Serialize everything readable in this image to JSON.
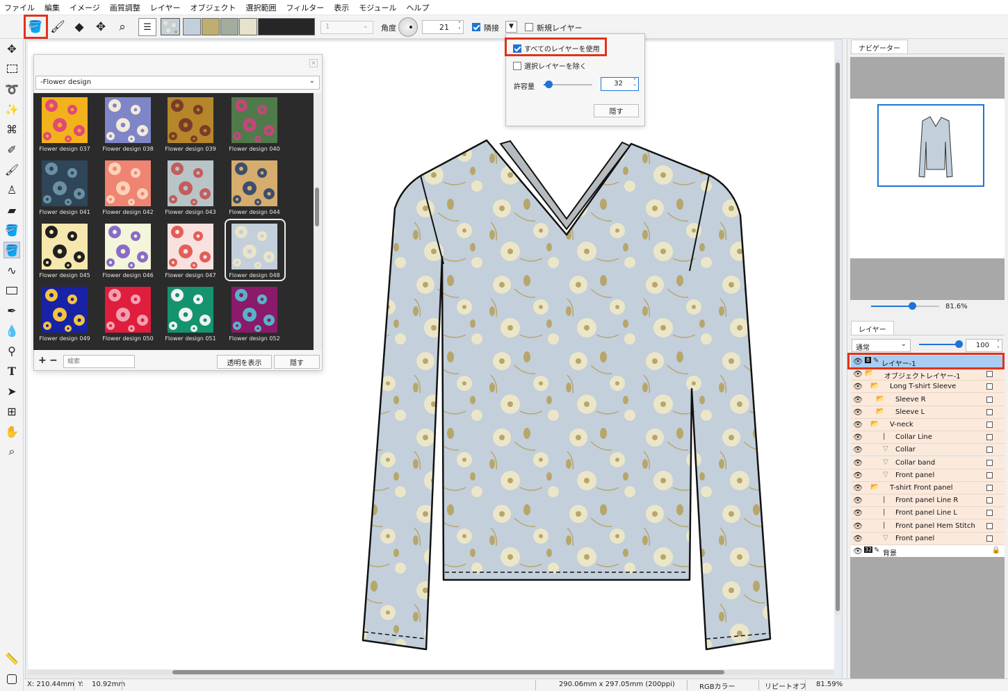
{
  "menu": [
    "ファイル",
    "編集",
    "イメージ",
    "画質調整",
    "レイヤー",
    "オブジェクト",
    "選択範囲",
    "フィルター",
    "表示",
    "モジュール",
    "ヘルプ"
  ],
  "toolbar": {
    "brush_size": "1",
    "angle_label": "角度",
    "angle_value": "21",
    "adjacent_label": "隣接",
    "new_layer_label": "新規レイヤー",
    "swatch_colors": [
      "#c3cfdb",
      "#bfae72",
      "#a3ad9d",
      "#e6e3cc",
      "#262626"
    ]
  },
  "popup": {
    "use_all_layers_label": "すべてのレイヤーを使用",
    "exclude_selected_label": "選択レイヤーを除く",
    "tolerance_label": "許容量",
    "tolerance_value": "32",
    "hide_label": "隠す"
  },
  "palette": {
    "category": "-Flower design",
    "search_placeholder": "検索",
    "show_transparent_label": "透明を表示",
    "hide_label": "隠す",
    "add_symbol": "+",
    "remove_symbol": "−",
    "patterns": [
      {
        "name": "Flower design 037",
        "bg": "#f2b21c",
        "fg": "#e04a76"
      },
      {
        "name": "Flower design 038",
        "bg": "#7f86c8",
        "fg": "#f3eada"
      },
      {
        "name": "Flower design 039",
        "bg": "#b5862a",
        "fg": "#7a3c2a"
      },
      {
        "name": "Flower design 040",
        "bg": "#4f7a49",
        "fg": "#c0487a"
      },
      {
        "name": "Flower design 041",
        "bg": "#2f4558",
        "fg": "#6b8fa3"
      },
      {
        "name": "Flower design 042",
        "bg": "#f08473",
        "fg": "#fbd1b8"
      },
      {
        "name": "Flower design 043",
        "bg": "#b9c4c7",
        "fg": "#c35d5c"
      },
      {
        "name": "Flower design 044",
        "bg": "#d6ad6e",
        "fg": "#3d4e6b"
      },
      {
        "name": "Flower design 045",
        "bg": "#f5e7ad",
        "fg": "#1f1f1f"
      },
      {
        "name": "Flower design 046",
        "bg": "#f3f6da",
        "fg": "#8a6cc7"
      },
      {
        "name": "Flower design 047",
        "bg": "#f8e2e0",
        "fg": "#e35e58"
      },
      {
        "name": "Flower design 048",
        "bg": "#c3cfdb",
        "fg": "#eae4c8"
      },
      {
        "name": "Flower design 049",
        "bg": "#1822a6",
        "fg": "#f2c53c"
      },
      {
        "name": "Flower design 050",
        "bg": "#df1d3c",
        "fg": "#f2a0b0"
      },
      {
        "name": "Flower design 051",
        "bg": "#14946e",
        "fg": "#f2f2f2"
      },
      {
        "name": "Flower design 052",
        "bg": "#8b1a6a",
        "fg": "#57b4c7"
      }
    ],
    "selected_index": 11
  },
  "navigator": {
    "tab_label": "ナビゲーター",
    "zoom": "81.6%",
    "zoom_fraction": 0.6
  },
  "layers": {
    "tab_label": "レイヤー",
    "blend_mode": "通常",
    "opacity": "100",
    "opacity_fraction": 0.95,
    "items": [
      {
        "name": "レイヤー-1",
        "indent": 0,
        "kind": "active"
      },
      {
        "name": "オブジェクトレイヤー-1",
        "indent": 1,
        "kind": "folder"
      },
      {
        "name": "Long T-shirt Sleeve",
        "indent": 2,
        "kind": "folder"
      },
      {
        "name": "Sleeve R",
        "indent": 3,
        "kind": "folder"
      },
      {
        "name": "Sleeve L",
        "indent": 3,
        "kind": "folder"
      },
      {
        "name": "V-neck",
        "indent": 2,
        "kind": "folder"
      },
      {
        "name": "Collar Line",
        "indent": 3,
        "kind": "line"
      },
      {
        "name": "Collar",
        "indent": 3,
        "kind": "shape"
      },
      {
        "name": "Collar band",
        "indent": 3,
        "kind": "shape"
      },
      {
        "name": "Front panel",
        "indent": 3,
        "kind": "shape"
      },
      {
        "name": "T-shirt Front panel",
        "indent": 2,
        "kind": "folder"
      },
      {
        "name": "Front panel Line R",
        "indent": 3,
        "kind": "line"
      },
      {
        "name": "Front panel Line L",
        "indent": 3,
        "kind": "line"
      },
      {
        "name": "Front panel Hem Stitch",
        "indent": 3,
        "kind": "line"
      },
      {
        "name": "Front panel",
        "indent": 3,
        "kind": "shape"
      },
      {
        "name": "背景",
        "indent": 0,
        "kind": "background"
      }
    ]
  },
  "status": {
    "x": "X: 210.44mm",
    "y": "Y:",
    "y_value": "10.92mm",
    "doc_size": "290.06mm x 297.05mm (200ppi)",
    "color_mode": "RGBカラー",
    "repeat": "リピートオフ",
    "zoom": "81.59%"
  },
  "badges": {
    "layer_depth": "8",
    "bg_depth": "32"
  },
  "garment": {
    "base_color": "#c3cfdb",
    "flower_color": "#ece6c9",
    "accent_color": "#b7a66a"
  }
}
